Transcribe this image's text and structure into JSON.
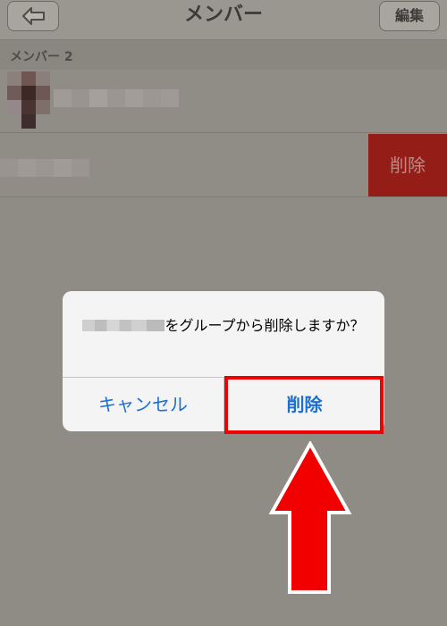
{
  "navbar": {
    "title": "メンバー",
    "edit_label": "編集",
    "back_icon": "back-arrow-icon"
  },
  "list": {
    "section_label": "メンバー 2",
    "swipe_delete_label": "削除"
  },
  "alert": {
    "message": "をグループから削除しますか？",
    "cancel_label": "キャンセル",
    "delete_label": "削除"
  },
  "annotation": {
    "highlight_color": "#f20000",
    "arrow_color": "#f20000"
  }
}
